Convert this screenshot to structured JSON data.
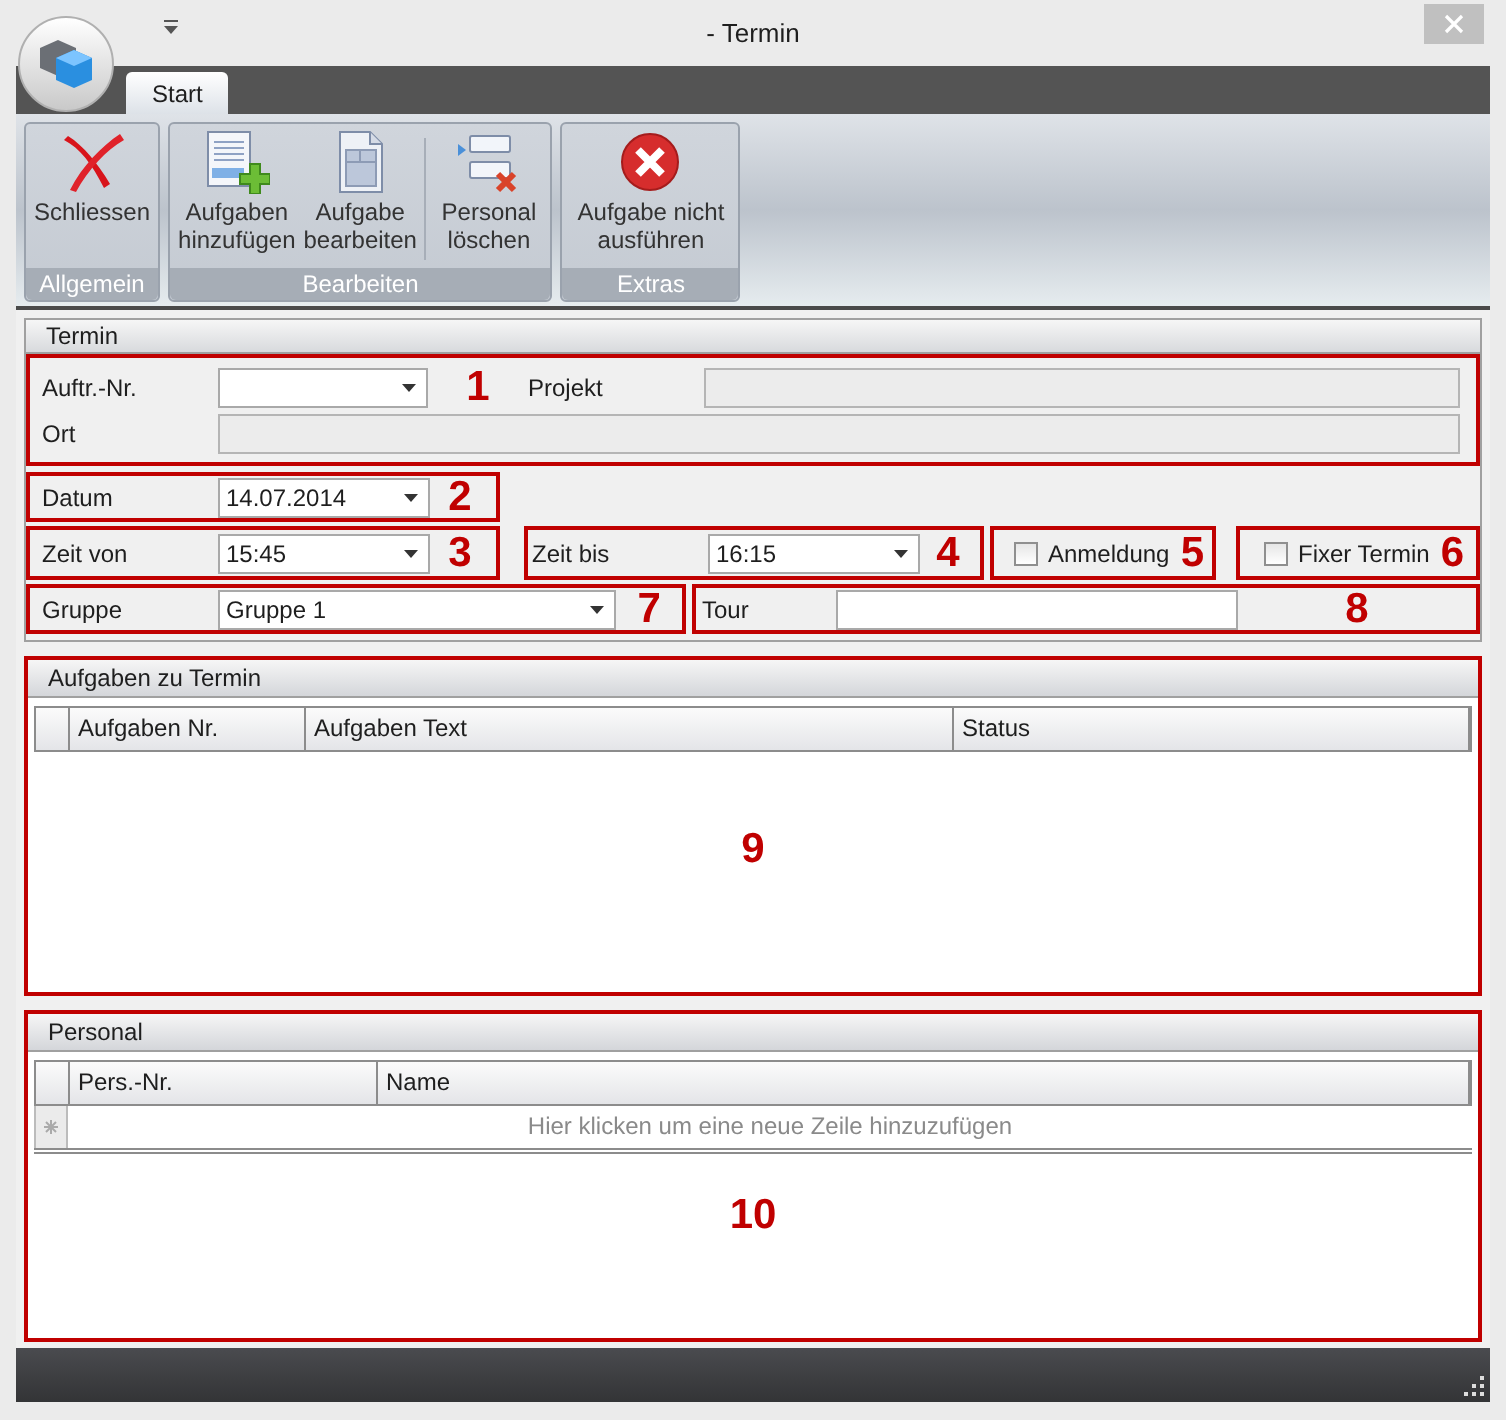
{
  "window": {
    "title": "- Termin"
  },
  "ribbon": {
    "tabs": [
      {
        "label": "Start",
        "selected": true
      }
    ],
    "groups": [
      {
        "label": "Allgemein",
        "buttons": [
          {
            "label": "Schliessen",
            "kind": "close"
          }
        ]
      },
      {
        "label": "Bearbeiten",
        "buttons": [
          {
            "label": "Aufgaben hinzufügen",
            "kind": "add"
          },
          {
            "label": "Aufgabe bearbeiten",
            "kind": "edit"
          },
          {
            "label": "Personal löschen",
            "kind": "remove"
          }
        ]
      },
      {
        "label": "Extras",
        "buttons": [
          {
            "label": "Aufgabe nicht ausführen",
            "kind": "cancel"
          }
        ]
      }
    ]
  },
  "termin": {
    "title": "Termin",
    "auftrag": {
      "label": "Auftr.-Nr."
    },
    "projekt": {
      "label": "Projekt"
    },
    "ort": {
      "label": "Ort"
    },
    "datum": {
      "label": "Datum",
      "value": "14.07.2014"
    },
    "zeit_von": {
      "label": "Zeit von",
      "value": "15:45"
    },
    "zeit_bis": {
      "label": "Zeit bis",
      "value": "16:15"
    },
    "anmeldung": {
      "label": "Anmeldung",
      "checked": false
    },
    "fixer_termin": {
      "label": "Fixer Termin",
      "checked": false
    },
    "gruppe": {
      "label": "Gruppe",
      "value": "Gruppe 1"
    },
    "tour": {
      "label": "Tour"
    }
  },
  "aufgaben": {
    "title": "Aufgaben zu Termin",
    "columns": [
      "Aufgaben Nr.",
      "Aufgaben Text",
      "Status"
    ]
  },
  "personal": {
    "title": "Personal",
    "columns": [
      "Pers.-Nr.",
      "Name"
    ],
    "new_row_hint": "Hier klicken um eine neue Zeile hinzuzufügen"
  },
  "callouts": [
    "1",
    "2",
    "3",
    "4",
    "5",
    "6",
    "7",
    "8",
    "9",
    "10"
  ]
}
